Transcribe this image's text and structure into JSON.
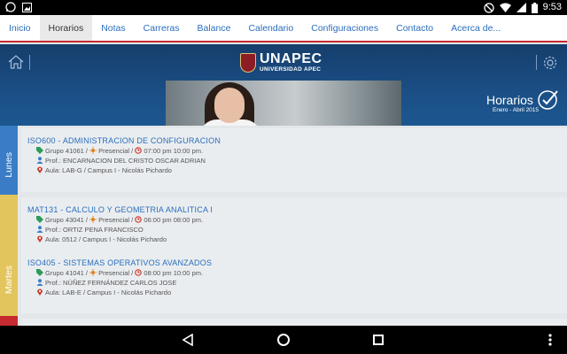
{
  "status_bar": {
    "time": "9:53",
    "left_icons": [
      "whatsapp-icon",
      "image-icon"
    ],
    "right_icons": [
      "do-not-disturb-icon",
      "wifi-icon",
      "signal-icon",
      "battery-icon"
    ]
  },
  "tabs": [
    {
      "label": "Inicio",
      "active": false
    },
    {
      "label": "Horarios",
      "active": true
    },
    {
      "label": "Notas",
      "active": false
    },
    {
      "label": "Carreras",
      "active": false
    },
    {
      "label": "Balance",
      "active": false
    },
    {
      "label": "Calendario",
      "active": false
    },
    {
      "label": "Configuraciones",
      "active": false
    },
    {
      "label": "Contacto",
      "active": false
    },
    {
      "label": "Acerca de...",
      "active": false
    }
  ],
  "header": {
    "logo_title": "UNAPEC",
    "logo_subtitle": "UNIVERSIDAD APEC",
    "section_title": "Horarios",
    "section_period": "Enero - Abril 2015",
    "colors": {
      "background": "#1b4f86",
      "accent": "#c62b2f"
    }
  },
  "days": [
    {
      "label": "Lunes",
      "color": "#3a7dc6",
      "courses": [
        {
          "title": "ISO600 - ADMINISTRACION DE CONFIGURACION",
          "group": "Grupo 41061",
          "mode": "Presencial",
          "time": "07:00 pm 10:00 pm.",
          "professor": "Prof.: ENCARNACION DEL CRISTO OSCAR ADRIAN",
          "room": "Aula: LAB-G / Campus I - Nicolás Pichardo"
        }
      ]
    },
    {
      "label": "Martes",
      "color": "#e3c55d",
      "courses": [
        {
          "title": "MAT131 - CALCULO Y GEOMETRIA ANALITICA I",
          "group": "Grupo 43041",
          "mode": "Presencial",
          "time": "06:00 pm 08:00 pm.",
          "professor": "Prof.: ORTIZ PENA FRANCISCO",
          "room": "Aula: 0512 / Campus I - Nicolás Pichardo"
        },
        {
          "title": "ISO405 - SISTEMAS OPERATIVOS AVANZADOS",
          "group": "Grupo 41041",
          "mode": "Presencial",
          "time": "08:00 pm 10:00 pm.",
          "professor": "Prof.: NÚÑEZ FERNÁNDEZ CARLOS JOSE",
          "room": "Aula: LAB-E / Campus I - Nicolás Pichardo"
        }
      ]
    },
    {
      "label": "",
      "color": "#c62b2f",
      "courses": []
    }
  ],
  "icon_colors": {
    "group": "#2e9b57",
    "mode": "#e0801d",
    "time": "#d03a2b",
    "professor": "#3a7dc6",
    "room": "#d03a2b"
  }
}
